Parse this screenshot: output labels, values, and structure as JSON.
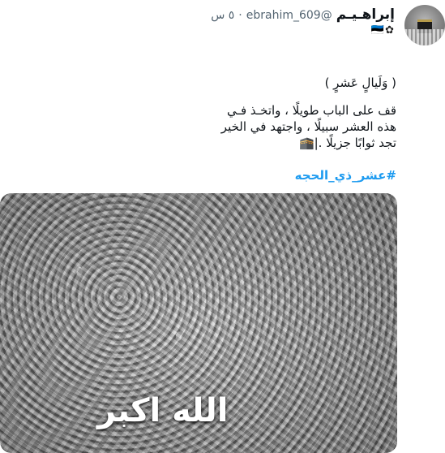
{
  "tweet": {
    "author": {
      "display_name": "إبراهـيـم",
      "handle": "@ebrahim_609",
      "badges": "🇪🇪✿"
    },
    "separator": "·",
    "time_ago": "٥ س",
    "text": {
      "title": "( وَلَيالٍ عَشرٍ )",
      "lines": [
        "قف على الباب طويلًا ، واتخـذ فـي",
        "هذه العشر سبيلًا ، واجتهد في الخير",
        "تجد ثوابًا جزيلًا .|🕋"
      ]
    },
    "hashtag": "#عشر_ذي_الحجه",
    "media": {
      "caption": "الله اكبر"
    }
  }
}
